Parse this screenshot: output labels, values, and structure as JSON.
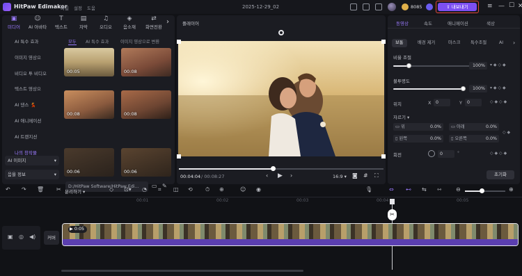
{
  "app": {
    "title": "HitPaw Edimakor",
    "project_name": "2025-12-29_02",
    "coins": "8085",
    "export_label": "내보내기"
  },
  "menu": [
    "파일",
    "설정",
    "도움"
  ],
  "categories": [
    {
      "label": "미디어",
      "icon": "media-icon",
      "active": true
    },
    {
      "label": "AI 아바타",
      "icon": "avatar-icon"
    },
    {
      "label": "텍스트",
      "icon": "text-icon"
    },
    {
      "label": "자막",
      "icon": "subtitle-icon"
    },
    {
      "label": "오디오",
      "icon": "audio-icon"
    },
    {
      "label": "음소재",
      "icon": "sticker-icon"
    },
    {
      "label": "화면전환",
      "icon": "transition-icon"
    }
  ],
  "side_items": [
    "AI 특수 효과",
    "이미지 영상으",
    "비디오 투 비디오",
    "텍스트 영상으",
    "AI 댄스 💃",
    "AI 애니메이션",
    "AI 트랜지션",
    "나의 창작물"
  ],
  "side_dropdowns": [
    "AI 이미지",
    "음을 정보"
  ],
  "sub_tabs": [
    "모두",
    "AI 특수 효과",
    "이미지 영상으로 변환"
  ],
  "thumbs": [
    "00:05",
    "00:08",
    "00:08",
    "00:08",
    "00:06",
    "00:06"
  ],
  "media_path": "D:/HitPaw Software/HitPaw Edi...",
  "preview": {
    "title": "플레이어",
    "time_current": "00:04:04",
    "time_total": "/ 00:08:27",
    "ratio": "16:9",
    "progress": 0.46
  },
  "props": {
    "tabs": [
      "동영상",
      "속도",
      "애니메이션",
      "색상"
    ],
    "sub_tabs": [
      "보통",
      "배경 제거",
      "마스크",
      "특수조절",
      "AI"
    ],
    "opacity_label": "비율 조절",
    "opacity_value": "100%",
    "blend_label": "불투명도",
    "blend_value": "100%",
    "position_label": "위치",
    "x_label": "X",
    "x_value": "0",
    "y_label": "Y",
    "y_value": "0",
    "crop_label": "자르기 ▾",
    "crop_top_label": "위",
    "crop_top": "0.0%",
    "crop_bottom_label": "아래",
    "crop_bottom": "0.0%",
    "crop_left_label": "왼쪽",
    "crop_left": "0.0%",
    "crop_right_label": "오른쪽",
    "crop_right": "0.0%",
    "rotate_label": "회전",
    "rotate_value": "0",
    "reset_label": "초기화"
  },
  "timeline": {
    "split_label": "분리하기",
    "ticks": [
      "00:01",
      "00:02",
      "00:03",
      "00:04",
      "00:05"
    ],
    "cover_label": "커버",
    "clip_duration": "0:05"
  }
}
